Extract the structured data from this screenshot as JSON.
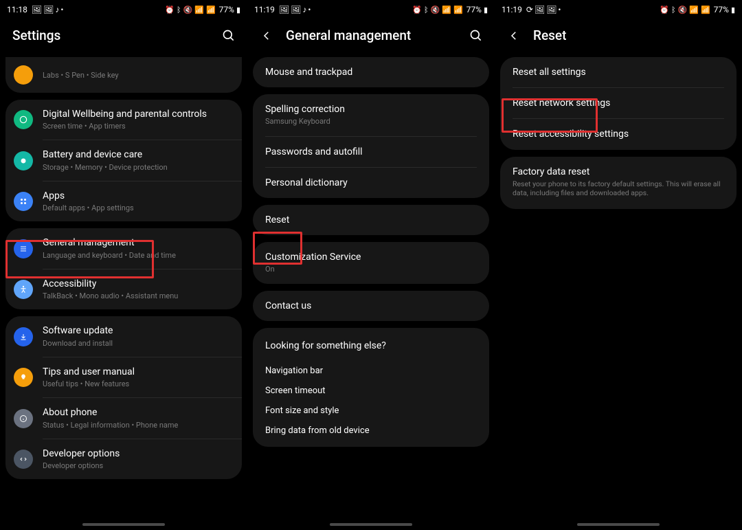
{
  "screens": [
    {
      "time": "11:18",
      "status_left_icons": [
        "picture-icon",
        "picture2-icon",
        "music-icon",
        "dot-icon"
      ],
      "status_right_icons": [
        "alarm-icon",
        "bluetooth-icon",
        "mute-icon",
        "wifi-icon",
        "signal-icon"
      ],
      "battery": "77%",
      "title": "Settings",
      "has_back": false,
      "has_search": true,
      "groups": [
        {
          "partial_top": true,
          "rows": [
            {
              "icon": "advanced-icon",
              "icon_class": "ic-orange",
              "title": "",
              "sub": "Labs  •  S Pen  •  Side key"
            }
          ]
        },
        {
          "rows": [
            {
              "icon": "wellbeing-icon",
              "icon_class": "ic-green",
              "title": "Digital Wellbeing and parental controls",
              "sub": "Screen time  •  App timers"
            },
            {
              "icon": "battery-icon",
              "icon_class": "ic-teal",
              "title": "Battery and device care",
              "sub": "Storage  •  Memory  •  Device protection"
            },
            {
              "icon": "apps-icon",
              "icon_class": "ic-blue",
              "title": "Apps",
              "sub": "Default apps  •  App settings"
            }
          ]
        },
        {
          "rows": [
            {
              "icon": "general-icon",
              "icon_class": "ic-dblue",
              "title": "General management",
              "sub": "Language and keyboard  •  Date and time",
              "highlight": true
            },
            {
              "icon": "accessibility-icon",
              "icon_class": "ic-bblue",
              "title": "Accessibility",
              "sub": "TalkBack  •  Mono audio  •  Assistant menu"
            }
          ]
        },
        {
          "rows": [
            {
              "icon": "update-icon",
              "icon_class": "ic-dblue",
              "title": "Software update",
              "sub": "Download and install"
            },
            {
              "icon": "tips-icon",
              "icon_class": "ic-amber",
              "title": "Tips and user manual",
              "sub": "Useful tips  •  New features"
            },
            {
              "icon": "about-icon",
              "icon_class": "ic-gray",
              "title": "About phone",
              "sub": "Status  •  Legal information  •  Phone name"
            },
            {
              "icon": "dev-icon",
              "icon_class": "ic-dgray",
              "title": "Developer options",
              "sub": "Developer options"
            }
          ]
        }
      ]
    },
    {
      "time": "11:19",
      "status_left_icons": [
        "picture-icon",
        "picture2-icon",
        "music-icon",
        "dot-icon"
      ],
      "status_right_icons": [
        "alarm-icon",
        "bluetooth-icon",
        "mute-icon",
        "wifi-icon",
        "signal-icon"
      ],
      "battery": "77%",
      "title": "General management",
      "has_back": true,
      "has_search": true,
      "groups": [
        {
          "rows": [
            {
              "title": "Mouse and trackpad",
              "sub": ""
            }
          ]
        },
        {
          "rows": [
            {
              "title": "Spelling correction",
              "sub": "Samsung Keyboard"
            },
            {
              "title": "Passwords and autofill",
              "sub": ""
            },
            {
              "title": "Personal dictionary",
              "sub": ""
            }
          ]
        },
        {
          "rows": [
            {
              "title": "Reset",
              "sub": "",
              "highlight": true
            }
          ]
        },
        {
          "rows": [
            {
              "title": "Customization Service",
              "sub": "On"
            }
          ]
        },
        {
          "rows": [
            {
              "title": "Contact us",
              "sub": ""
            }
          ]
        }
      ],
      "footer": {
        "heading": "Looking for something else?",
        "links": [
          "Navigation bar",
          "Screen timeout",
          "Font size and style",
          "Bring data from old device"
        ]
      }
    },
    {
      "time": "11:19",
      "status_left_icons": [
        "sync-icon",
        "picture-icon",
        "picture2-icon",
        "dot-icon"
      ],
      "status_right_icons": [
        "alarm-icon",
        "bluetooth-icon",
        "mute-icon",
        "wifi-icon",
        "signal-icon"
      ],
      "battery": "77%",
      "title": "Reset",
      "has_back": true,
      "has_search": false,
      "groups": [
        {
          "rows": [
            {
              "title": "Reset all settings",
              "sub": ""
            },
            {
              "title": "Reset network settings",
              "sub": "",
              "highlight": true
            },
            {
              "title": "Reset accessibility settings",
              "sub": ""
            }
          ]
        },
        {
          "rows": [
            {
              "title": "Factory data reset",
              "sub": "Reset your phone to its factory default settings. This will erase all data, including files and downloaded apps."
            }
          ]
        }
      ]
    }
  ]
}
